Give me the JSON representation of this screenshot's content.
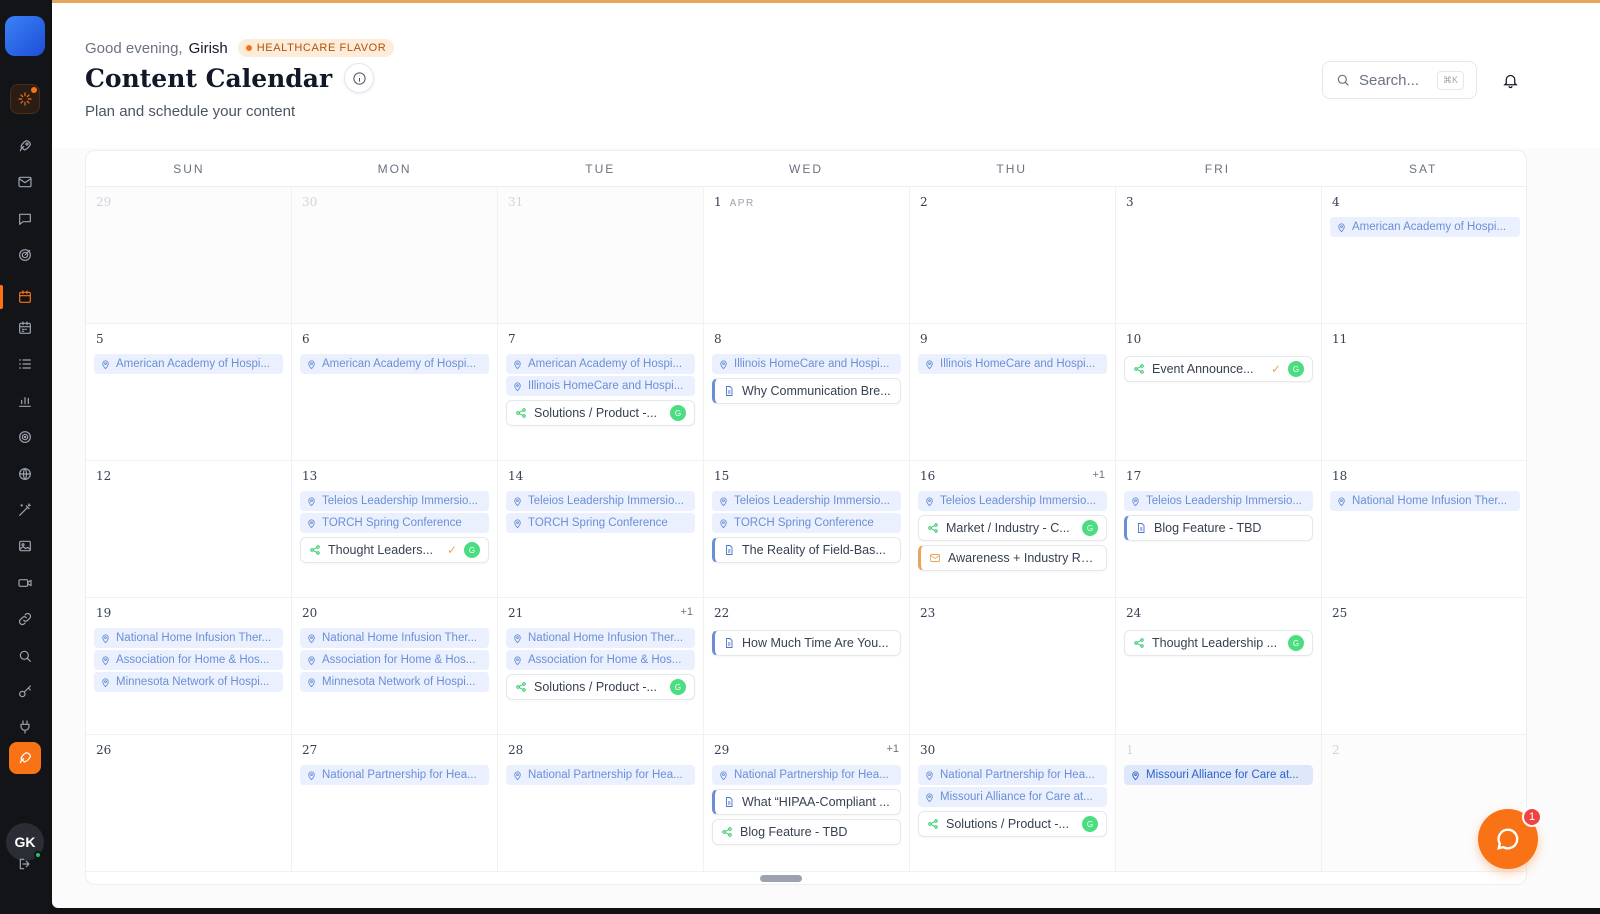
{
  "header": {
    "greeting": "Good evening,",
    "user_name": "Girish",
    "flavor_badge": "HEALTHCARE FLAVOR",
    "title": "Content Calendar",
    "subtitle": "Plan and schedule your content",
    "search_placeholder": "Search...",
    "search_shortcut": "⌘K"
  },
  "sidebar": {
    "avatar_initials": "GK",
    "icons": [
      "sparkle-icon",
      "rocket-icon",
      "mail-icon",
      "chat-icon",
      "target-icon",
      "calendar-icon",
      "calendar-grid-icon",
      "list-icon",
      "bar-chart-icon",
      "radar-icon",
      "globe-icon",
      "magic-wand-icon",
      "image-icon",
      "video-icon",
      "link-icon",
      "search-icon",
      "key-icon",
      "plug-icon",
      "launch-icon",
      "logout-icon"
    ]
  },
  "colors": {
    "accent": "#f97316",
    "event_bg": "#eaf0fd",
    "event_text": "#6b8fd6",
    "badge_green": "#4ade80"
  },
  "calendar": {
    "weekdays": [
      "SUN",
      "MON",
      "TUE",
      "WED",
      "THU",
      "FRI",
      "SAT"
    ],
    "month_tag": "APR",
    "weeks": [
      [
        {
          "day": "29",
          "outside": true,
          "items": []
        },
        {
          "day": "30",
          "outside": true,
          "items": []
        },
        {
          "day": "31",
          "outside": true,
          "items": []
        },
        {
          "day": "1",
          "tag": "APR",
          "items": []
        },
        {
          "day": "2",
          "items": []
        },
        {
          "day": "3",
          "items": []
        },
        {
          "day": "4",
          "items": [
            {
              "kind": "event",
              "text": "American Academy of Hospi..."
            }
          ]
        }
      ],
      [
        {
          "day": "5",
          "items": [
            {
              "kind": "event",
              "text": "American Academy of Hospi..."
            }
          ]
        },
        {
          "day": "6",
          "items": [
            {
              "kind": "event",
              "text": "American Academy of Hospi..."
            }
          ]
        },
        {
          "day": "7",
          "items": [
            {
              "kind": "event",
              "text": "American Academy of Hospi..."
            },
            {
              "kind": "event",
              "text": "Illinois HomeCare and Hospi..."
            },
            {
              "kind": "social",
              "text": "Solutions / Product -...",
              "badge": "G"
            }
          ]
        },
        {
          "day": "8",
          "items": [
            {
              "kind": "event",
              "text": "Illinois HomeCare and Hospi..."
            },
            {
              "kind": "blog",
              "text": "Why Communication Bre..."
            }
          ]
        },
        {
          "day": "9",
          "items": [
            {
              "kind": "event",
              "text": "Illinois HomeCare and Hospi..."
            }
          ]
        },
        {
          "day": "10",
          "items": [
            {
              "kind": "social",
              "text": "Event Announce...",
              "check": "✓",
              "badge": "G"
            }
          ]
        },
        {
          "day": "11",
          "items": []
        }
      ],
      [
        {
          "day": "12",
          "items": []
        },
        {
          "day": "13",
          "items": [
            {
              "kind": "event",
              "text": "Teleios Leadership Immersio..."
            },
            {
              "kind": "event",
              "text": "TORCH Spring Conference"
            },
            {
              "kind": "social",
              "text": "Thought Leaders...",
              "check": "✓",
              "badge": "G"
            }
          ]
        },
        {
          "day": "14",
          "items": [
            {
              "kind": "event",
              "text": "Teleios Leadership Immersio..."
            },
            {
              "kind": "event",
              "text": "TORCH Spring Conference"
            }
          ]
        },
        {
          "day": "15",
          "items": [
            {
              "kind": "event",
              "text": "Teleios Leadership Immersio..."
            },
            {
              "kind": "event",
              "text": "TORCH Spring Conference"
            },
            {
              "kind": "blog",
              "text": "The Reality of Field-Bas..."
            }
          ]
        },
        {
          "day": "16",
          "more": "+1",
          "items": [
            {
              "kind": "event",
              "text": "Teleios Leadership Immersio..."
            },
            {
              "kind": "social",
              "text": "Market / Industry - C...",
              "badge": "G"
            },
            {
              "kind": "email",
              "text": "Awareness + Industry Re..."
            }
          ]
        },
        {
          "day": "17",
          "items": [
            {
              "kind": "event",
              "text": "Teleios Leadership Immersio..."
            },
            {
              "kind": "blog",
              "text": "Blog Feature - TBD"
            }
          ]
        },
        {
          "day": "18",
          "items": [
            {
              "kind": "event",
              "text": "National Home Infusion Ther..."
            }
          ]
        }
      ],
      [
        {
          "day": "19",
          "items": [
            {
              "kind": "event",
              "text": "National Home Infusion Ther..."
            },
            {
              "kind": "event",
              "text": "Association for Home & Hos..."
            },
            {
              "kind": "event",
              "text": "Minnesota Network of Hospi..."
            }
          ]
        },
        {
          "day": "20",
          "items": [
            {
              "kind": "event",
              "text": "National Home Infusion Ther..."
            },
            {
              "kind": "event",
              "text": "Association for Home & Hos..."
            },
            {
              "kind": "event",
              "text": "Minnesota Network of Hospi..."
            }
          ]
        },
        {
          "day": "21",
          "more": "+1",
          "items": [
            {
              "kind": "event",
              "text": "National Home Infusion Ther..."
            },
            {
              "kind": "event",
              "text": "Association for Home & Hos..."
            },
            {
              "kind": "social",
              "text": "Solutions / Product -...",
              "badge": "G"
            }
          ]
        },
        {
          "day": "22",
          "items": [
            {
              "kind": "blog",
              "text": "How Much Time Are You..."
            }
          ]
        },
        {
          "day": "23",
          "items": []
        },
        {
          "day": "24",
          "items": [
            {
              "kind": "social",
              "text": "Thought Leadership ...",
              "badge": "G"
            }
          ]
        },
        {
          "day": "25",
          "items": []
        }
      ],
      [
        {
          "day": "26",
          "items": []
        },
        {
          "day": "27",
          "items": [
            {
              "kind": "event",
              "text": "National Partnership for Hea..."
            }
          ]
        },
        {
          "day": "28",
          "items": [
            {
              "kind": "event",
              "text": "National Partnership for Hea..."
            }
          ]
        },
        {
          "day": "29",
          "more": "+1",
          "items": [
            {
              "kind": "event",
              "text": "National Partnership for Hea..."
            },
            {
              "kind": "blog",
              "text": "What “HIPAA-Compliant ..."
            },
            {
              "kind": "social-plain",
              "text": "Blog Feature - TBD"
            }
          ]
        },
        {
          "day": "30",
          "items": [
            {
              "kind": "event",
              "text": "National Partnership for Hea..."
            },
            {
              "kind": "event",
              "text": "Missouri Alliance for Care at..."
            },
            {
              "kind": "social",
              "text": "Solutions / Product -...",
              "badge": "G"
            }
          ]
        },
        {
          "day": "1",
          "outside": true,
          "items": [
            {
              "kind": "event-strong",
              "text": "Missouri Alliance for Care at..."
            }
          ]
        },
        {
          "day": "2",
          "outside": true,
          "items": []
        }
      ]
    ]
  },
  "chat": {
    "unread": "1"
  }
}
